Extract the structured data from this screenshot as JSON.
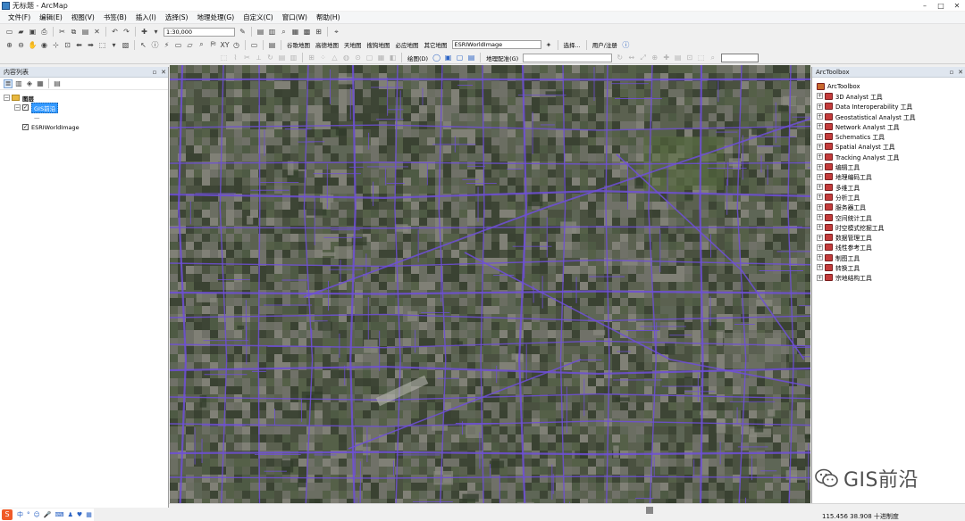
{
  "window": {
    "title": "无标题 - ArcMap"
  },
  "menu": [
    "文件(F)",
    "编辑(E)",
    "视图(V)",
    "书签(B)",
    "插入(I)",
    "选择(S)",
    "地理处理(G)",
    "自定义(C)",
    "窗口(W)",
    "帮助(H)"
  ],
  "toolbar": {
    "scale": "1:30,000",
    "basemap_menus": [
      "谷歌地图",
      "高德地图",
      "天地图",
      "搜狗地图",
      "必应地图",
      "其它地图"
    ],
    "layer_select": "ESRIWorldImage",
    "select_label": "选择...",
    "user_label": "用户/注册",
    "draw_label": "绘图(D)",
    "georef_label": "地理配准(G)"
  },
  "toc": {
    "title": "内容列表",
    "layers": {
      "group": "图层",
      "gis_layer": "GIS前沿",
      "gis_symbol": "—",
      "world_image": "ESRIWorldImage"
    }
  },
  "toolbox": {
    "title": "ArcToolbox",
    "root": "ArcToolbox",
    "items": [
      "3D Analyst 工具",
      "Data Interoperability 工具",
      "Geostatistical Analyst 工具",
      "Network Analyst 工具",
      "Schematics 工具",
      "Spatial Analyst 工具",
      "Tracking Analyst 工具",
      "编辑工具",
      "地理编码工具",
      "多维工具",
      "分析工具",
      "服务器工具",
      "空间统计工具",
      "时空模式挖掘工具",
      "数据管理工具",
      "线性参考工具",
      "制图工具",
      "转换工具",
      "宗地结构工具"
    ]
  },
  "watermark": "GIS前沿",
  "status": {
    "coords": "115.456  38.908 十进制度"
  },
  "ime": {
    "logo": "S",
    "keys": [
      "中",
      "°",
      "☺",
      "🎤",
      "⌨",
      "♟",
      "♥",
      "▦"
    ]
  },
  "colors": {
    "road": "#6f4fd8",
    "imagery": "#3e4535",
    "selection": "#3399ff"
  }
}
